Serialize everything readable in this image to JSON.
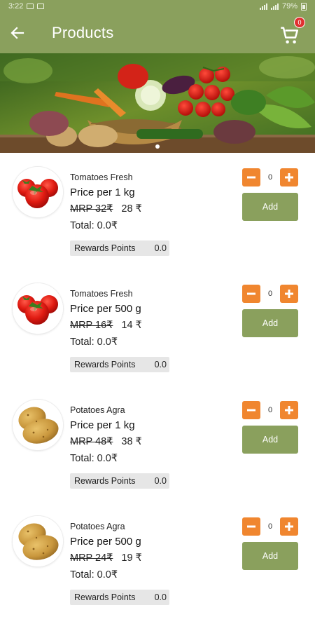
{
  "status_bar": {
    "time": "3:22",
    "battery": "79%"
  },
  "app_bar": {
    "title": "Products",
    "back_icon": "arrow-left-icon",
    "cart_icon": "cart-icon",
    "cart_count": "0"
  },
  "banner": {
    "image": "vegetable-basket-banner",
    "slides": 2,
    "active_slide": 1
  },
  "colors": {
    "primary": "#8aa05d",
    "accent": "#f0862f",
    "badge": "#e03030",
    "rewards_bg": "#e6e6e6"
  },
  "products": [
    {
      "image": "tomatoes",
      "name": "Tomatoes Fresh",
      "unit": "Price per 1 kg",
      "mrp_label": "MRP",
      "mrp_value": "32",
      "currency": "₹",
      "price": "28 ₹",
      "total": "Total: 0.0₹",
      "rewards_label": "Rewards Points",
      "rewards_value": "0.0",
      "qty": "0",
      "add_label": "Add"
    },
    {
      "image": "tomatoes",
      "name": "Tomatoes Fresh",
      "unit": "Price per 500 g",
      "mrp_label": "MRP",
      "mrp_value": "16",
      "currency": "₹",
      "price": "14 ₹",
      "total": "Total: 0.0₹",
      "rewards_label": "Rewards Points",
      "rewards_value": "0.0",
      "qty": "0",
      "add_label": "Add"
    },
    {
      "image": "potatoes",
      "name": "Potatoes Agra",
      "unit": "Price per 1 kg",
      "mrp_label": "MRP",
      "mrp_value": "48",
      "currency": "₹",
      "price": "38 ₹",
      "total": "Total: 0.0₹",
      "rewards_label": "Rewards Points",
      "rewards_value": "0.0",
      "qty": "0",
      "add_label": "Add"
    },
    {
      "image": "potatoes",
      "name": "Potatoes Agra",
      "unit": "Price per 500 g",
      "mrp_label": "MRP",
      "mrp_value": "24",
      "currency": "₹",
      "price": "19 ₹",
      "total": "Total: 0.0₹",
      "rewards_label": "Rewards Points",
      "rewards_value": "0.0",
      "qty": "0",
      "add_label": "Add"
    }
  ]
}
